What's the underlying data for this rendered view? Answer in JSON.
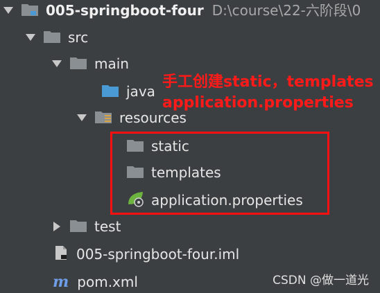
{
  "project": {
    "name": "005-springboot-four",
    "path": "D:\\course\\22-六阶段\\0"
  },
  "tree": {
    "src": "src",
    "main": "main",
    "java": "java",
    "resources": "resources",
    "static": "static",
    "templates": "templates",
    "application_properties": "application.properties",
    "test": "test",
    "iml_file": "005-springboot-four.iml",
    "pom": "pom.xml"
  },
  "annotation": {
    "line1": "手工创建static，templates",
    "line2": "application.properties",
    "color": "#ff1a1a"
  },
  "watermark": "CSDN @做一道光",
  "colors": {
    "background": "#3c3f41",
    "folder": "#8a8f94",
    "source_folder": "#4a9ad6",
    "maven_icon": "#6f9ee8",
    "spring_leaf": "#6db33f"
  },
  "icons": {
    "expanded": "chevron-down-icon",
    "collapsed": "chevron-right-icon",
    "folder": "folder-icon",
    "module": "module-folder-icon",
    "source_root": "source-root-folder-icon",
    "resources_root": "resources-root-folder-icon",
    "spring_properties": "spring-properties-icon",
    "iml": "iml-file-icon",
    "maven": "maven-icon"
  }
}
